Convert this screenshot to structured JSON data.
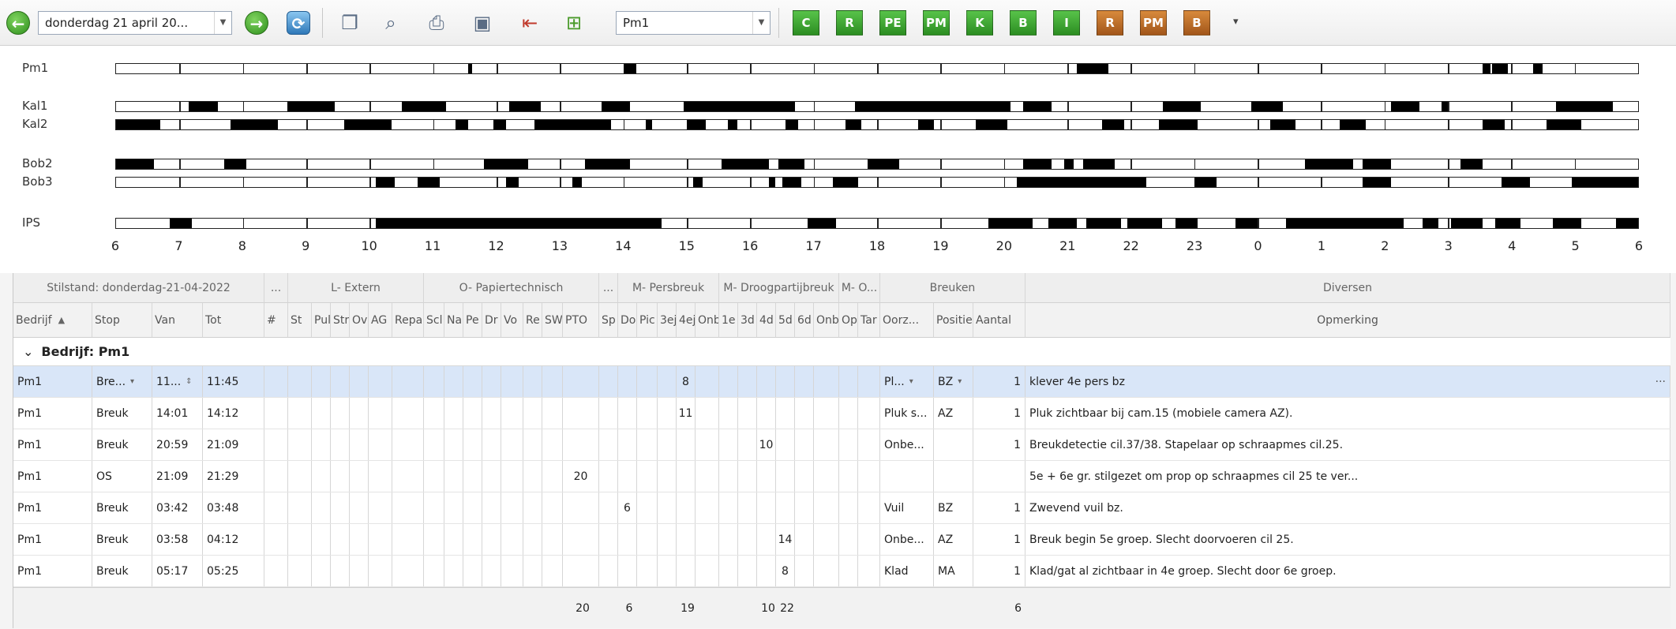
{
  "toolbar": {
    "back_glyph": "←",
    "date_value": "donderdag 21 april 20...",
    "forward_glyph": "→",
    "refresh_glyph": "⟳",
    "machine_value": "Pm1",
    "buttons": [
      {
        "label": "C",
        "color": "green"
      },
      {
        "label": "R",
        "color": "green"
      },
      {
        "label": "PE",
        "color": "green"
      },
      {
        "label": "PM",
        "color": "green"
      },
      {
        "label": "K",
        "color": "green"
      },
      {
        "label": "B",
        "color": "green"
      },
      {
        "label": "I",
        "color": "green"
      },
      {
        "label": "R",
        "color": "brown"
      },
      {
        "label": "PM",
        "color": "brown"
      },
      {
        "label": "B",
        "color": "brown"
      }
    ],
    "more_glyph": "▾"
  },
  "gantt": {
    "hour_labels": [
      "6",
      "7",
      "8",
      "9",
      "10",
      "11",
      "12",
      "13",
      "14",
      "15",
      "16",
      "17",
      "18",
      "19",
      "20",
      "21",
      "22",
      "23",
      "0",
      "1",
      "2",
      "3",
      "4",
      "5",
      "6"
    ],
    "rows": [
      {
        "label": "Pm1",
        "stops": [
          [
            5.55,
            5.62
          ],
          [
            8.0,
            8.2
          ],
          [
            15.15,
            15.65
          ],
          [
            21.55,
            21.67
          ],
          [
            21.7,
            21.95
          ],
          [
            22.35,
            22.5
          ]
        ]
      },
      {
        "label": "Kal1",
        "stops": [
          [
            1.15,
            1.6
          ],
          [
            2.7,
            3.45
          ],
          [
            4.5,
            5.2
          ],
          [
            6.2,
            6.7
          ],
          [
            7.65,
            8.1
          ],
          [
            8.95,
            10.7
          ],
          [
            11.65,
            14.1
          ],
          [
            14.3,
            14.75
          ],
          [
            16.5,
            17.1
          ],
          [
            17.9,
            18.4
          ],
          [
            20.1,
            20.55
          ],
          [
            20.9,
            21.0
          ],
          [
            22.7,
            23.6
          ]
        ]
      },
      {
        "label": "Kal2",
        "stops": [
          [
            0.0,
            0.7
          ],
          [
            1.8,
            2.55
          ],
          [
            3.6,
            4.35
          ],
          [
            5.35,
            5.55
          ],
          [
            5.95,
            6.15
          ],
          [
            6.6,
            7.8
          ],
          [
            8.35,
            8.45
          ],
          [
            9.0,
            9.3
          ],
          [
            9.65,
            9.8
          ],
          [
            10.55,
            10.75
          ],
          [
            11.5,
            11.75
          ],
          [
            12.65,
            12.9
          ],
          [
            13.55,
            14.05
          ],
          [
            15.55,
            15.9
          ],
          [
            16.45,
            17.05
          ],
          [
            18.2,
            18.6
          ],
          [
            19.3,
            19.7
          ],
          [
            21.55,
            21.9
          ],
          [
            22.55,
            23.1
          ]
        ]
      },
      {
        "label": "Bob2",
        "stops": [
          [
            0.0,
            0.6
          ],
          [
            1.7,
            2.05
          ],
          [
            5.8,
            6.5
          ],
          [
            7.4,
            8.1
          ],
          [
            9.55,
            10.3
          ],
          [
            10.45,
            10.85
          ],
          [
            11.85,
            12.35
          ],
          [
            14.3,
            14.75
          ],
          [
            14.95,
            15.1
          ],
          [
            15.25,
            15.75
          ],
          [
            18.75,
            19.5
          ],
          [
            19.65,
            20.1
          ],
          [
            21.2,
            21.55
          ]
        ]
      },
      {
        "label": "Bob3",
        "stops": [
          [
            4.1,
            4.4
          ],
          [
            4.75,
            5.1
          ],
          [
            6.15,
            6.35
          ],
          [
            7.2,
            7.35
          ],
          [
            9.1,
            9.25
          ],
          [
            10.3,
            10.4
          ],
          [
            10.5,
            10.8
          ],
          [
            11.3,
            11.7
          ],
          [
            14.2,
            16.25
          ],
          [
            17.0,
            17.35
          ],
          [
            19.65,
            20.1
          ],
          [
            21.85,
            22.3
          ],
          [
            22.95,
            24.0
          ]
        ]
      },
      {
        "label": "IPS",
        "stops": [
          [
            0.85,
            1.2
          ],
          [
            4.1,
            8.6
          ],
          [
            10.9,
            11.35
          ],
          [
            13.75,
            14.45
          ],
          [
            14.7,
            15.15
          ],
          [
            15.3,
            15.85
          ],
          [
            15.95,
            16.5
          ],
          [
            16.7,
            17.05
          ],
          [
            17.65,
            18.0
          ],
          [
            18.45,
            20.3
          ],
          [
            20.6,
            20.85
          ],
          [
            21.05,
            21.55
          ],
          [
            21.75,
            22.15
          ],
          [
            22.65,
            23.1
          ],
          [
            23.65,
            24.0
          ]
        ]
      }
    ]
  },
  "grid": {
    "bands": [
      "Stilstand: donderdag-21-04-2022",
      "...",
      "L- Extern",
      "O- Papiertechnisch",
      "...",
      "M- Persbreuk",
      "M- Droogpartijbreuk",
      "M- O...",
      "Breuken",
      "Diversen"
    ],
    "columns": [
      "Bedrijf",
      "Stop",
      "Van",
      "Tot",
      "#",
      "St",
      "Pul",
      "Str",
      "Ov",
      "AG",
      "Repa",
      "Scl",
      "Na",
      "Pe",
      "Dr",
      "Vo",
      "Re",
      "SW",
      "PTO",
      "Sp",
      "Do",
      "Pic",
      "3ej",
      "4ej",
      "Onb",
      "1e",
      "3d",
      "4d",
      "5d",
      "6d",
      "Onb",
      "Op",
      "Tar",
      "Oorz...",
      "Positie",
      "Aantal",
      "Opmerking"
    ],
    "sort_glyph": "▲",
    "group_label": "Bedrijf: Pm1",
    "group_glyph": "⌄",
    "rows": [
      {
        "bedrijf": "Pm1",
        "stop": "Bre...",
        "van": "11...",
        "tot": "11:45",
        "num_col": "4ej",
        "num": "8",
        "oorzaak": "Pl...",
        "positie": "BZ",
        "aantal": "1",
        "opmerking": "klever 4e pers bz"
      },
      {
        "bedrijf": "Pm1",
        "stop": "Breuk",
        "van": "14:01",
        "tot": "14:12",
        "num_col": "4ej",
        "num": "11",
        "oorzaak": "Pluk s...",
        "positie": "AZ",
        "aantal": "1",
        "opmerking": "Pluk zichtbaar bij cam.15 (mobiele camera AZ)."
      },
      {
        "bedrijf": "Pm1",
        "stop": "Breuk",
        "van": "20:59",
        "tot": "21:09",
        "num_col": "4d",
        "num": "10",
        "oorzaak": "Onbe...",
        "positie": "",
        "aantal": "1",
        "opmerking": "Breukdetectie cil.37/38. Stapelaar op schraapmes cil.25."
      },
      {
        "bedrijf": "Pm1",
        "stop": "OS",
        "van": "21:09",
        "tot": "21:29",
        "num_col": "PTO",
        "num": "20",
        "oorzaak": "",
        "positie": "",
        "aantal": "",
        "opmerking": "5e + 6e gr. stilgezet om prop op schraapmes cil 25 te ver..."
      },
      {
        "bedrijf": "Pm1",
        "stop": "Breuk",
        "van": "03:42",
        "tot": "03:48",
        "num_col": "Do",
        "num": "6",
        "oorzaak": "Vuil",
        "positie": "BZ",
        "aantal": "1",
        "opmerking": "Zwevend vuil bz."
      },
      {
        "bedrijf": "Pm1",
        "stop": "Breuk",
        "van": "03:58",
        "tot": "04:12",
        "num_col": "5d",
        "num": "14",
        "oorzaak": "Onbe...",
        "positie": "AZ",
        "aantal": "1",
        "opmerking": "Breuk begin 5e groep. Slecht doorvoeren cil 25."
      },
      {
        "bedrijf": "Pm1",
        "stop": "Breuk",
        "van": "05:17",
        "tot": "05:25",
        "num_col": "5d",
        "num": "8",
        "oorzaak": "Klad",
        "positie": "MA",
        "aantal": "1",
        "opmerking": "Klad/gat al zichtbaar in 4e groep. Slecht door 6e groep."
      }
    ],
    "totals": [
      {
        "col": "PTO",
        "value": "20"
      },
      {
        "col": "Do",
        "value": "6"
      },
      {
        "col": "4ej",
        "value": "19"
      },
      {
        "col": "4d",
        "value": "10"
      },
      {
        "col": "5d",
        "value": "22"
      },
      {
        "col": "Aantal",
        "value": "6"
      }
    ],
    "ellipsis_glyph": "···",
    "dropdown_glyph": "▾",
    "spin_glyph": "⇕"
  },
  "colors": {
    "selected_row": "#d9e6f8",
    "tag_green": "#2c8d22",
    "tag_brown": "#a2561a"
  }
}
